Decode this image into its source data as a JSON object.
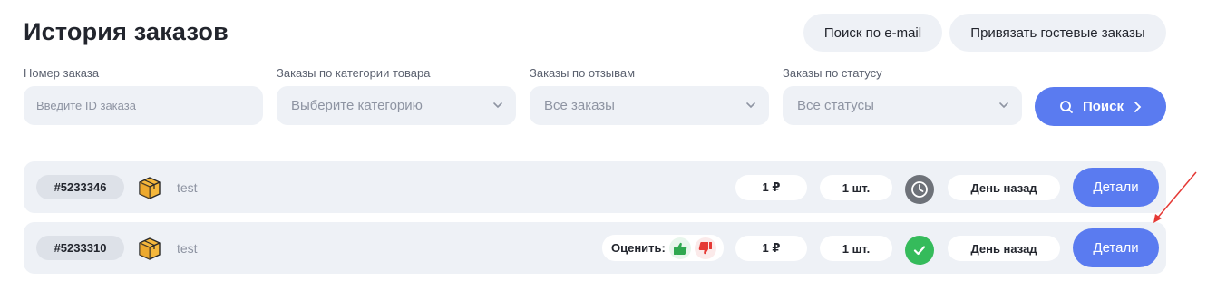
{
  "page": {
    "title": "История заказов"
  },
  "header_buttons": {
    "email_search": "Поиск по e-mail",
    "link_guest": "Привязать гостевые заказы"
  },
  "filters": {
    "order_number": {
      "label": "Номер заказа",
      "placeholder": "Введите ID заказа"
    },
    "category": {
      "label": "Заказы по категории товара",
      "value": "Выберите категорию"
    },
    "reviews": {
      "label": "Заказы по отзывам",
      "value": "Все заказы"
    },
    "status": {
      "label": "Заказы по статусу",
      "value": "Все статусы"
    },
    "search_label": "Поиск"
  },
  "orders": [
    {
      "id": "#5233346",
      "name": "test",
      "price": "1 ₽",
      "qty": "1 шт.",
      "status_icon": "clock-icon",
      "date": "День назад",
      "details": "Детали"
    },
    {
      "id": "#5233310",
      "name": "test",
      "rate_label": "Оценить:",
      "price": "1 ₽",
      "qty": "1 шт.",
      "status_icon": "check-icon",
      "date": "День назад",
      "details": "Детали"
    }
  ],
  "colors": {
    "accent": "#5a7bf0",
    "panel": "#eef1f6",
    "success": "#35bb5b",
    "pending": "#6e7279",
    "annotation": "#e53935"
  }
}
